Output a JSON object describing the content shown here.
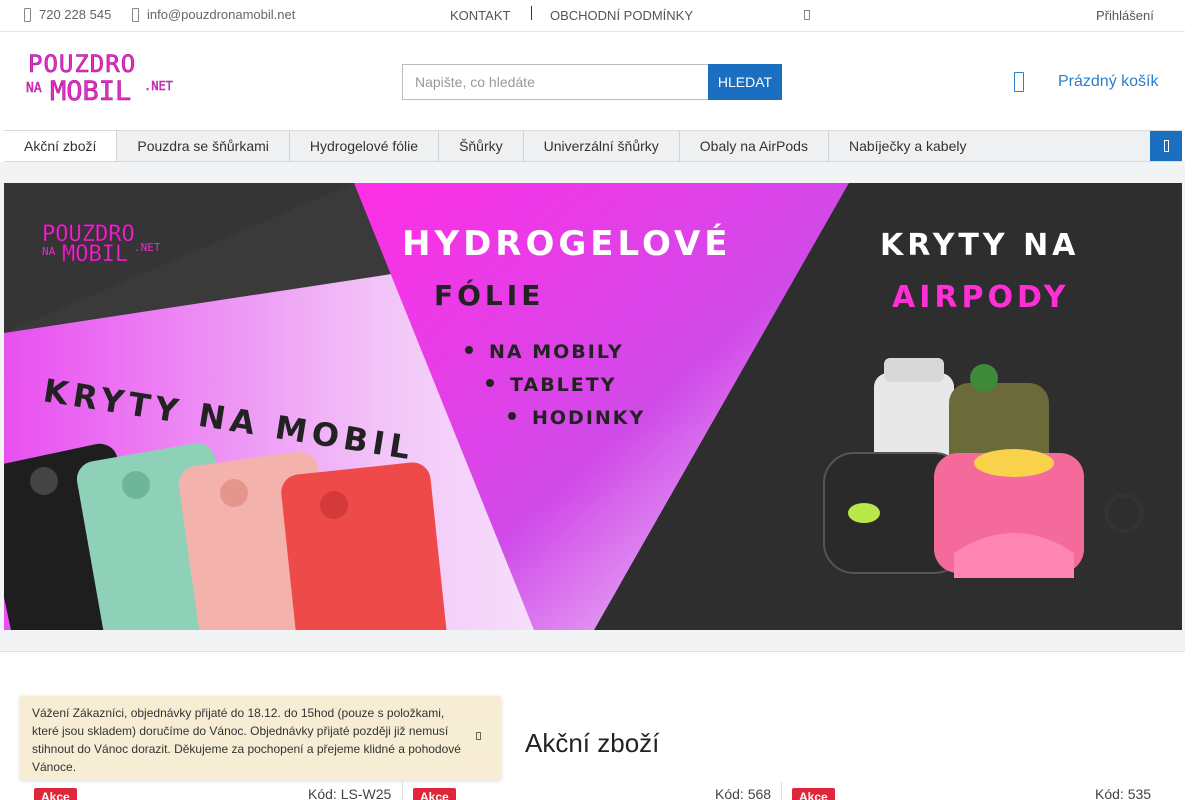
{
  "topbar": {
    "phone": "720 228 545",
    "email": "info@pouzdronamobil.net",
    "links": [
      "KONTAKT",
      "OBCHODNÍ PODMÍNKY"
    ],
    "login": "Přihlášení"
  },
  "header": {
    "logo_text": "POUZDRO NA MOBIL .NET",
    "search_placeholder": "Napište, co hledáte",
    "search_button": "HLEDAT",
    "cart_label": "Prázdný košík"
  },
  "categories": [
    "Akční zboží",
    "Pouzdra se šňůrkami",
    "Hydrogelové fólie",
    "Šňůrky",
    "Univerzální šňůrky",
    "Obaly na AirPods",
    "Nabíječky a kabely"
  ],
  "banner": {
    "logo_text": "POUZDRO NA MOBIL .NET",
    "hydro_title_1": "HYDROGELOVÉ",
    "hydro_title_2": "FÓLIE",
    "bullets": [
      "NA MOBILY",
      "TABLETY",
      "HODINKY"
    ],
    "airpods_title_1": "KRYTY NA",
    "airpods_title_2": "AIRPODY",
    "mobil_title": "KRYTY NA MOBIL"
  },
  "notice": {
    "text": "Vážení Zákazníci, objednávky přijaté do 18.12. do 15hod (pouze s položkami, které jsou skladem) doručíme do Vánoc. Objednávky přijaté později již nemusí stihnout do Vánoc dorazit. Děkujeme za pochopení a přejeme klidné a pohodové Vánoce."
  },
  "section_title": "Akční zboží",
  "products": [
    {
      "badge": "Akce",
      "code": "Kód: LS-W25"
    },
    {
      "badge": "Akce",
      "code": "Kód: 568"
    },
    {
      "badge": "Akce",
      "code": "Kód: 535"
    }
  ],
  "colors": {
    "accent": "#1b6fc0",
    "badge": "#e0263a",
    "logo_pink": "#e92bc8",
    "banner_magenta": "#e010d8"
  }
}
